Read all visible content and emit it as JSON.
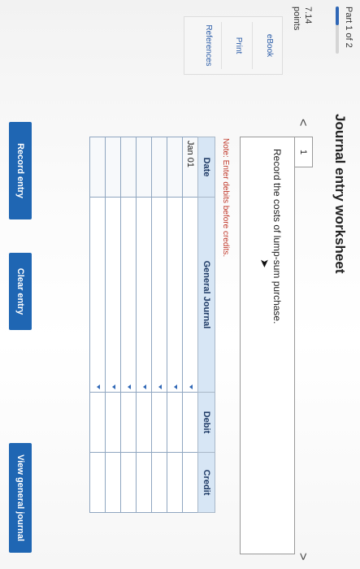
{
  "sidebar": {
    "part": "Part 1 of 2",
    "part_progress": 0.4,
    "points_value": "7.14",
    "points_label": "points",
    "links": [
      "eBook",
      "Print",
      "References"
    ]
  },
  "worksheet": {
    "title": "Journal entry worksheet",
    "nav_prev": "<",
    "nav_next": ">",
    "step": "1",
    "instruction": "Record the costs of lump-sum purchase.",
    "note": "Note: Enter debits before credits."
  },
  "table": {
    "headers": [
      "Date",
      "General Journal",
      "Debit",
      "Credit"
    ],
    "rows": [
      {
        "date": "Jan 01"
      },
      {
        "date": ""
      },
      {
        "date": ""
      },
      {
        "date": ""
      },
      {
        "date": ""
      },
      {
        "date": ""
      },
      {
        "date": ""
      }
    ]
  },
  "buttons": {
    "record": "Record entry",
    "clear": "Clear entry",
    "view": "View general journal"
  },
  "colors": {
    "accent": "#1f66b3",
    "header_bg": "#d7e6f5",
    "note": "#c0392b"
  }
}
